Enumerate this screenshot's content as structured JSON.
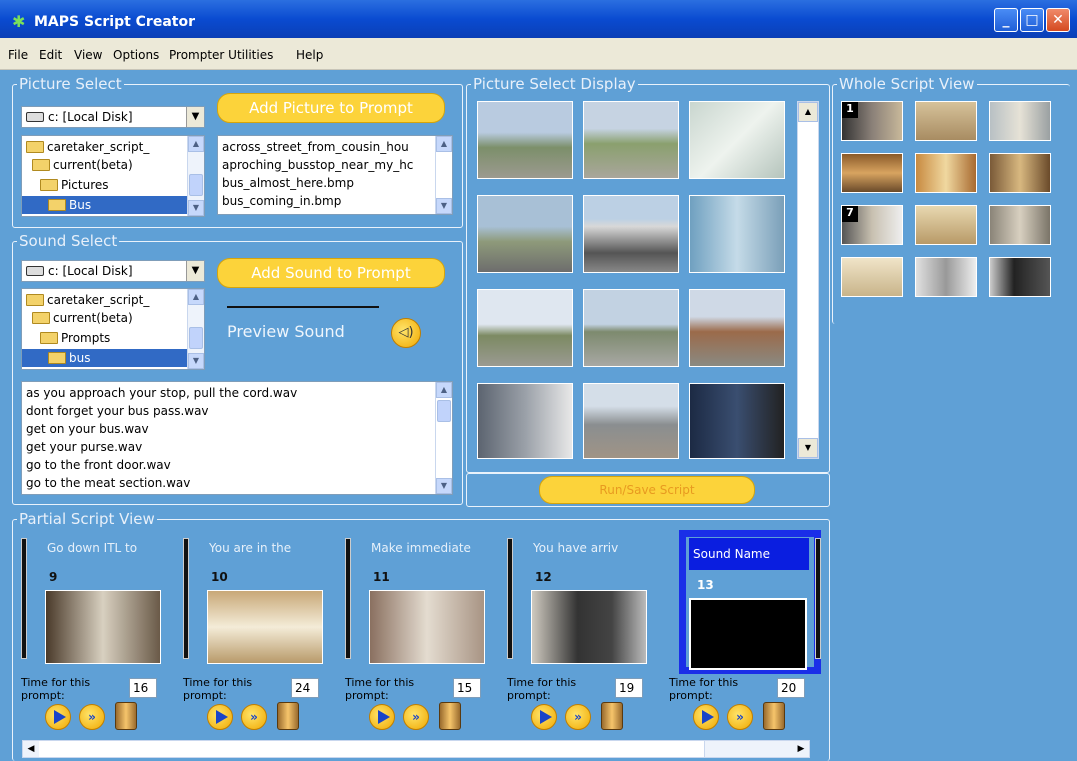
{
  "window": {
    "title": "MAPS Script Creator",
    "minimize": "_",
    "maximize": "□",
    "close": "✕"
  },
  "menu": [
    "File",
    "Edit",
    "View",
    "Options",
    "Prompter Utilities",
    "Help"
  ],
  "picture_select": {
    "legend": "Picture Select",
    "drive": "c: [Local Disk]",
    "add_button": "Add Picture to Prompt",
    "folders": [
      "caretaker_script_",
      "current(beta)",
      "Pictures",
      "Bus"
    ],
    "files": [
      "across_street_from_cousin_hou",
      "aproching_busstop_near_my_hc",
      "bus_almost_here.bmp",
      "bus_coming_in.bmp"
    ]
  },
  "sound_select": {
    "legend": "Sound Select",
    "drive": "c: [Local Disk]",
    "add_button": "Add Sound to Prompt",
    "preview_label": "Preview Sound",
    "folders": [
      "caretaker_script_",
      "current(beta)",
      "Prompts",
      "bus"
    ],
    "files": [
      "as you approach your stop, pull the cord.wav",
      "dont forget your bus pass.wav",
      "get on your bus.wav",
      "get your purse.wav",
      "go to the front door.wav",
      "go to the meat section.wav"
    ]
  },
  "picture_display": {
    "legend": "Picture Select Display",
    "run_button": "Run/Save Script"
  },
  "whole_script": {
    "legend": "Whole Script View",
    "markers": [
      "1",
      "7"
    ]
  },
  "partial_script": {
    "legend": "Partial Script View",
    "time_label": "Time for this prompt:",
    "slots": [
      {
        "name": "Go down ITL to",
        "num": "9",
        "time": "16"
      },
      {
        "name": "You are in the",
        "num": "10",
        "time": "24"
      },
      {
        "name": "Make immediate",
        "num": "11",
        "time": "15"
      },
      {
        "name": "You have arriv",
        "num": "12",
        "time": "19"
      },
      {
        "name": "Sound Name",
        "num": "13",
        "time": "20"
      }
    ]
  },
  "scrollbar": {
    "left": "◀",
    "right": "▶",
    "up": "▲",
    "down": "▼"
  },
  "colors": {
    "panel": "#5fa0d6",
    "accent": "#fcd33a",
    "selection": "#1a2ee8"
  },
  "icons": {
    "speaker": "speaker-icon",
    "play": "play-icon",
    "trash": "trash-icon"
  }
}
